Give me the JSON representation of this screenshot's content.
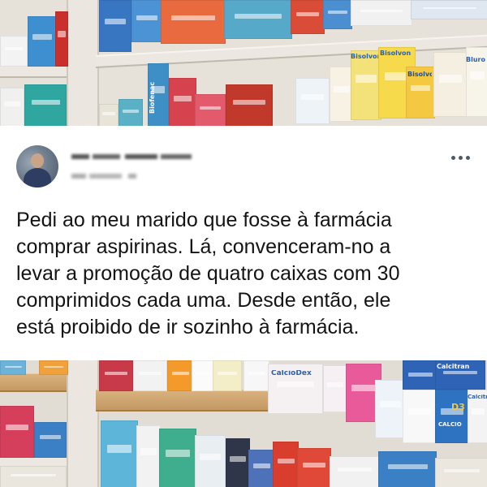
{
  "post": {
    "author_name": "▬ ▬▬▬▬ ▬▬▬▬",
    "author_meta": "▬▬ ▬▬▬ ▬",
    "more_label": "•••",
    "text": "Pedi ao meu marido que fosse à farmácia\ncomprar aspirinas. Lá, convenceram-no a\nlevar a promoção de quatro caixas com 30\ncomprimidos cada uma. Desde então, ele\nestá proibido de ir sozinho à farmácia."
  },
  "background": {
    "top_labels": [
      "Bisolvon",
      "Bisolvon",
      "Bisolvon",
      "Bluro",
      "Biofenac"
    ],
    "bottom_labels": [
      "CalcioDex",
      "Calcitran",
      "D3",
      "CALCIO",
      "Calcitran"
    ]
  },
  "colors": {
    "card": "#ffffff",
    "text": "#141414",
    "dots": "#505a64"
  }
}
